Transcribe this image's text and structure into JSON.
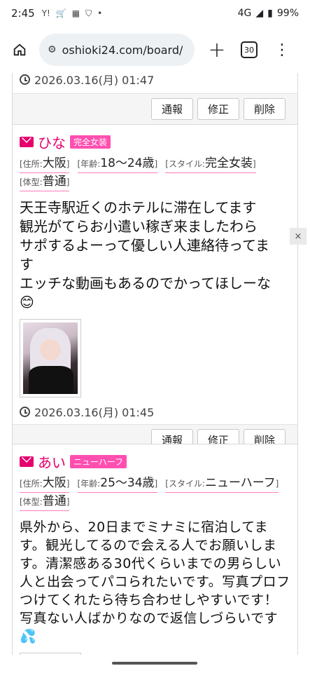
{
  "status": {
    "time": "2:45",
    "icons": [
      "Y!",
      "cart-icon",
      "calendar-icon",
      "shield-icon",
      "•"
    ],
    "network": "4G",
    "battery": "99%"
  },
  "browser": {
    "url": "oshioki24.com/board/",
    "tab_count": "30"
  },
  "actions": {
    "report": "通報",
    "edit": "修正",
    "delete": "削除"
  },
  "posts": [
    {
      "timestamp": "2026.03.16(月) 01:47"
    },
    {
      "name": "ひな",
      "tag": "完全女装",
      "attrs": [
        {
          "k": "[住所:",
          "v": "大阪",
          "e": "]"
        },
        {
          "k": "[年齢:",
          "v": "18〜24歳",
          "e": "]"
        },
        {
          "k": "[スタイル:",
          "v": "完全女装",
          "e": "]"
        },
        {
          "k": "[体型:",
          "v": "普通",
          "e": "]"
        }
      ],
      "lines": [
        "天王寺駅近くのホテルに滞在してます",
        "観光がてらお小遣い稼ぎ来ましたわら",
        "サポするよーって優しい人連絡待ってま",
        "す",
        "エッチな動画もあるのでかってほしーな",
        "😊"
      ],
      "timestamp": "2026.03.16(月) 01:45"
    },
    {
      "name": "あい",
      "tag": "ニューハーフ",
      "attrs": [
        {
          "k": "[住所:",
          "v": "大阪",
          "e": "]"
        },
        {
          "k": "[年齢:",
          "v": "25〜34歳",
          "e": "]"
        },
        {
          "k": "[スタイル:",
          "v": "ニューハーフ",
          "e": "]"
        },
        {
          "k": "[体型:",
          "v": "普通",
          "e": "]"
        }
      ],
      "body": "県外から、20日までミナミに宿泊してます。観光してるので会える人でお願いします。清潔感ある30代くらいまでの男らしい人と出会ってパコられたいです。写真プロフつけてくれたら待ち合わせしやすいです！写真ない人ばかりなので返信しづらいです💦"
    }
  ],
  "close_label": "×",
  "colors": {
    "accent": "#e5006e",
    "tag": "#ff4fb0"
  }
}
